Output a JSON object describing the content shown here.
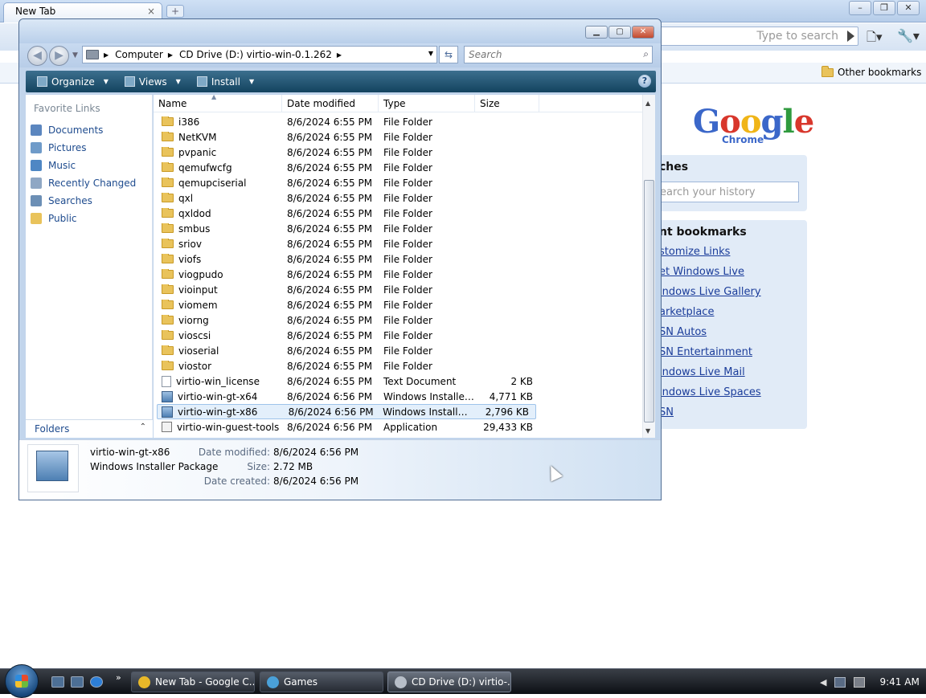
{
  "chrome": {
    "tab_title": "New Tab",
    "tab_close": "×",
    "new_tab": "+",
    "omnibox_placeholder": "Type to search",
    "other_bookmarks": "Other bookmarks",
    "logo_text": [
      "G",
      "o",
      "o",
      "g",
      "l",
      "e"
    ],
    "logo_sub": "Chrome",
    "searches_title": "ches",
    "search_history_placeholder": "earch your history",
    "bookmarks_title": "nt bookmarks",
    "bookmarks": [
      "stomize Links",
      "et Windows Live",
      "indows Live Gallery",
      "arketplace",
      "SN Autos",
      "SN Entertainment",
      "indows Live Mail",
      "indows Live Spaces",
      "SN"
    ]
  },
  "explorer": {
    "breadcrumb": [
      "Computer",
      "CD Drive (D:) virtio-win-0.1.262"
    ],
    "search_placeholder": "Search",
    "commands": [
      "Organize",
      "Views",
      "Install"
    ],
    "help": "?",
    "favorite_links_title": "Favorite Links",
    "favorite_links": [
      {
        "label": "Documents",
        "icon": "documents-icon",
        "color": "#5b86bf"
      },
      {
        "label": "Pictures",
        "icon": "pictures-icon",
        "color": "#6f9bc9"
      },
      {
        "label": "Music",
        "icon": "music-icon",
        "color": "#4f87c4"
      },
      {
        "label": "Recently Changed",
        "icon": "recent-icon",
        "color": "#8fa7c4"
      },
      {
        "label": "Searches",
        "icon": "searches-icon",
        "color": "#6c8fb5"
      },
      {
        "label": "Public",
        "icon": "public-folder-icon",
        "color": "#e9c35b"
      }
    ],
    "folders_label": "Folders",
    "columns": [
      "Name",
      "Date modified",
      "Type",
      "Size"
    ],
    "files": [
      {
        "name": "i386",
        "date": "8/6/2024 6:55 PM",
        "type": "File Folder",
        "size": "",
        "kind": "folder"
      },
      {
        "name": "NetKVM",
        "date": "8/6/2024 6:55 PM",
        "type": "File Folder",
        "size": "",
        "kind": "folder"
      },
      {
        "name": "pvpanic",
        "date": "8/6/2024 6:55 PM",
        "type": "File Folder",
        "size": "",
        "kind": "folder"
      },
      {
        "name": "qemufwcfg",
        "date": "8/6/2024 6:55 PM",
        "type": "File Folder",
        "size": "",
        "kind": "folder"
      },
      {
        "name": "qemupciserial",
        "date": "8/6/2024 6:55 PM",
        "type": "File Folder",
        "size": "",
        "kind": "folder"
      },
      {
        "name": "qxl",
        "date": "8/6/2024 6:55 PM",
        "type": "File Folder",
        "size": "",
        "kind": "folder"
      },
      {
        "name": "qxldod",
        "date": "8/6/2024 6:55 PM",
        "type": "File Folder",
        "size": "",
        "kind": "folder"
      },
      {
        "name": "smbus",
        "date": "8/6/2024 6:55 PM",
        "type": "File Folder",
        "size": "",
        "kind": "folder"
      },
      {
        "name": "sriov",
        "date": "8/6/2024 6:55 PM",
        "type": "File Folder",
        "size": "",
        "kind": "folder"
      },
      {
        "name": "viofs",
        "date": "8/6/2024 6:55 PM",
        "type": "File Folder",
        "size": "",
        "kind": "folder"
      },
      {
        "name": "viogpudo",
        "date": "8/6/2024 6:55 PM",
        "type": "File Folder",
        "size": "",
        "kind": "folder"
      },
      {
        "name": "vioinput",
        "date": "8/6/2024 6:55 PM",
        "type": "File Folder",
        "size": "",
        "kind": "folder"
      },
      {
        "name": "viomem",
        "date": "8/6/2024 6:55 PM",
        "type": "File Folder",
        "size": "",
        "kind": "folder"
      },
      {
        "name": "viorng",
        "date": "8/6/2024 6:55 PM",
        "type": "File Folder",
        "size": "",
        "kind": "folder"
      },
      {
        "name": "vioscsi",
        "date": "8/6/2024 6:55 PM",
        "type": "File Folder",
        "size": "",
        "kind": "folder"
      },
      {
        "name": "vioserial",
        "date": "8/6/2024 6:55 PM",
        "type": "File Folder",
        "size": "",
        "kind": "folder"
      },
      {
        "name": "viostor",
        "date": "8/6/2024 6:55 PM",
        "type": "File Folder",
        "size": "",
        "kind": "folder"
      },
      {
        "name": "virtio-win_license",
        "date": "8/6/2024 6:55 PM",
        "type": "Text Document",
        "size": "2 KB",
        "kind": "doc"
      },
      {
        "name": "virtio-win-gt-x64",
        "date": "8/6/2024 6:56 PM",
        "type": "Windows Installer ...",
        "size": "4,771 KB",
        "kind": "msi"
      },
      {
        "name": "virtio-win-gt-x86",
        "date": "8/6/2024 6:56 PM",
        "type": "Windows Installer ...",
        "size": "2,796 KB",
        "kind": "msi",
        "selected": true
      },
      {
        "name": "virtio-win-guest-tools",
        "date": "8/6/2024 6:56 PM",
        "type": "Application",
        "size": "29,433 KB",
        "kind": "app"
      }
    ],
    "details": {
      "name": "virtio-win-gt-x86",
      "kind": "Windows Installer Package",
      "modified_label": "Date modified:",
      "modified": "8/6/2024 6:56 PM",
      "size_label": "Size:",
      "size": "2.72 MB",
      "created_label": "Date created:",
      "created": "8/6/2024 6:56 PM"
    }
  },
  "taskbar": {
    "ql_more": "»",
    "tasks": [
      {
        "label": "New Tab - Google C...",
        "icon": "chrome-icon",
        "color": "#e8b829"
      },
      {
        "label": "Games",
        "icon": "games-icon",
        "color": "#4aa0d8"
      },
      {
        "label": "CD Drive (D:) virtio-...",
        "icon": "cd-drive-icon",
        "color": "#b7bec8"
      }
    ],
    "clock": "9:41 AM"
  }
}
